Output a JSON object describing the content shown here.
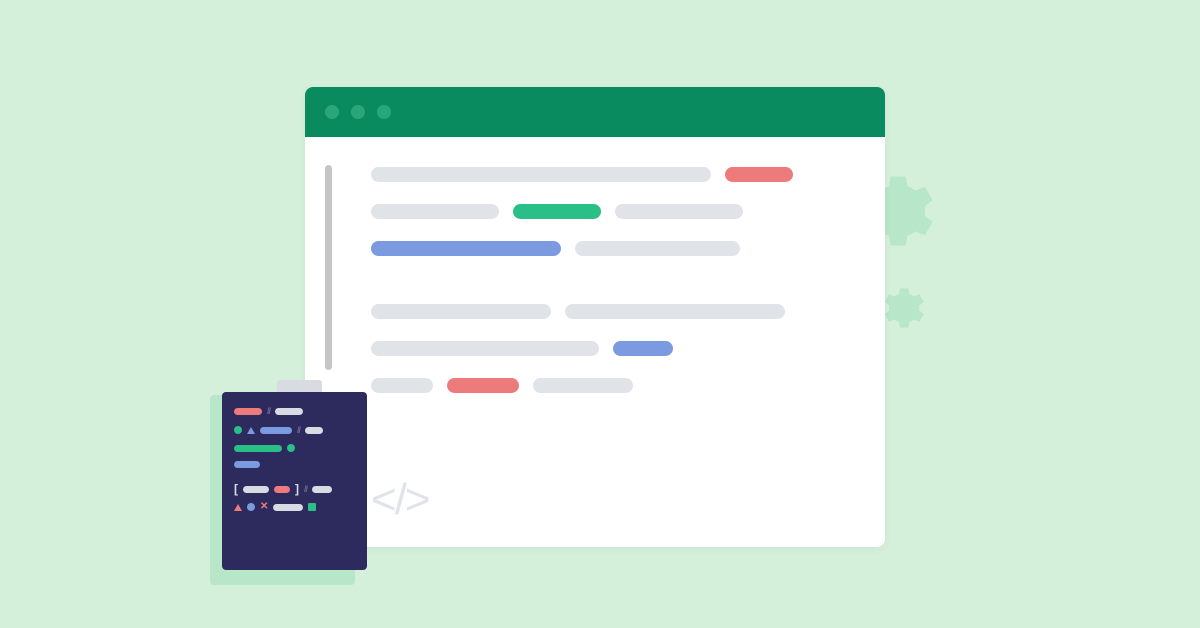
{
  "image_kind": "illustration",
  "description": "Decorative flat illustration of a browser window containing abstract code/text bars, a small dark code-file card in the foreground, and pale gear icons in the background. No readable textual content.",
  "palette": {
    "background": "#d4f0db",
    "gear": "#b8e6c8",
    "titlebar": "#0a8a5f",
    "titlebar_dot": "#2ba57a",
    "window_bg": "#ffffff",
    "scrollbar": "#c5c5c5",
    "pill_grey": "#e0e4e9",
    "pill_red": "#ee7b7b",
    "pill_green": "#2bbf88",
    "pill_blue": "#7b9ae0",
    "folder_body": "#2d2a5e",
    "folder_tab": "#d8dce2",
    "folder_shadow": "#b8e6c8",
    "code_muted": "#6b6890"
  },
  "code_tag_glyph": "</>"
}
